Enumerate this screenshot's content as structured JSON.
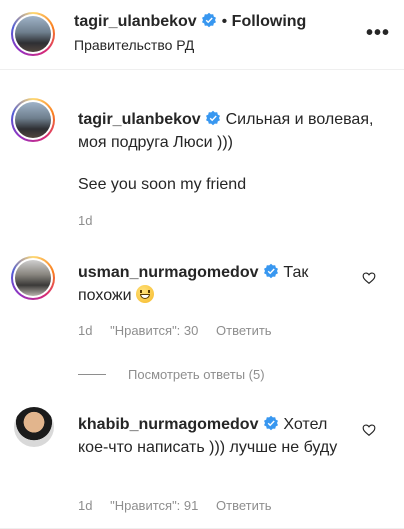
{
  "header": {
    "username": "tagir_ulanbekov",
    "dot": "•",
    "follow_status": "Following",
    "subtitle": "Правительство РД",
    "more_label": "•••"
  },
  "caption": {
    "username": "tagir_ulanbekov",
    "text": "Сильная и волевая, моя подруга Люси )))",
    "text2": "See you soon my friend",
    "time": "1d"
  },
  "comments": [
    {
      "username": "usman_nurmagomedov",
      "text": "Так похожи",
      "emoji": "smiling-face-emoji",
      "time": "1d",
      "likes": "\"Нравится\": 30",
      "reply": "Ответить"
    },
    {
      "username": "khabib_nurmagomedov",
      "text": "Хотел кое-что написать ))) лучше не буду",
      "time": "1d",
      "likes": "\"Нравится\": 91",
      "reply": "Ответить"
    }
  ],
  "view_replies": "Посмотреть ответы (5)",
  "colors": {
    "verified": "#3897f0",
    "meta_text": "#8e8e8e",
    "text": "#262626"
  }
}
